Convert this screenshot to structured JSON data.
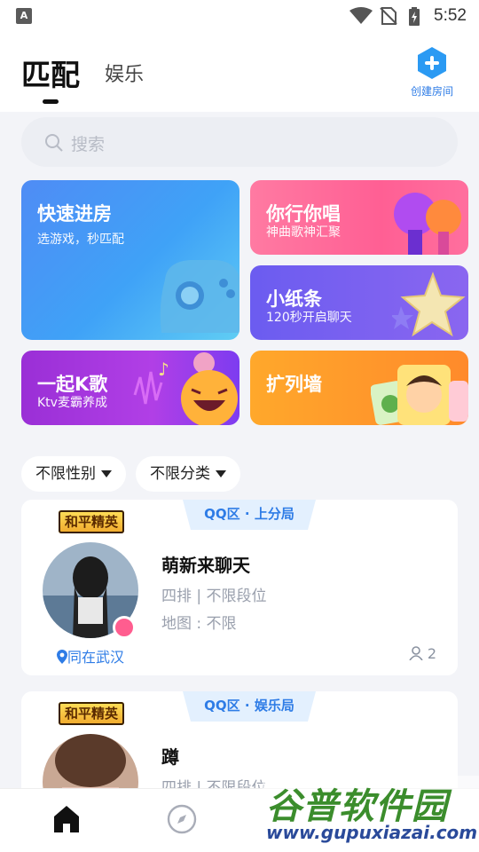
{
  "status_bar": {
    "time": "5:52",
    "app_badge": "A"
  },
  "header": {
    "tabs": [
      {
        "label": "匹配",
        "active": true
      },
      {
        "label": "娱乐",
        "active": false
      }
    ],
    "create_room_label": "创建房间"
  },
  "search": {
    "placeholder": "搜索"
  },
  "cards": {
    "quick": {
      "title": "快速进房",
      "subtitle": "选游戏，秒匹配"
    },
    "sing": {
      "title": "你行你唱",
      "subtitle": "神曲歌神汇聚"
    },
    "note": {
      "title": "小纸条",
      "subtitle": "120秒开启聊天"
    },
    "ksong": {
      "title": "一起K歌",
      "subtitle": "Ktv麦霸养成"
    },
    "wall": {
      "title": "扩列墙"
    }
  },
  "filters": {
    "gender": "不限性别",
    "category": "不限分类"
  },
  "rooms": [
    {
      "zone": "QQ区 · 上分局",
      "game_logo": "和平精英",
      "name": "萌新来聊天",
      "mode": "四排 | 不限段位",
      "map": "地图 : 不限",
      "location": "同在武汉",
      "count": "2"
    },
    {
      "zone": "QQ区 · 娱乐局",
      "game_logo": "和平精英",
      "name": "蹲",
      "mode": "四排 | 不限段位"
    }
  ],
  "watermark": {
    "big": "谷普软件园",
    "small": "www.gupuxiazai.com"
  },
  "colors": {
    "accent": "#2e7ce6",
    "background": "#f3f4f8"
  }
}
